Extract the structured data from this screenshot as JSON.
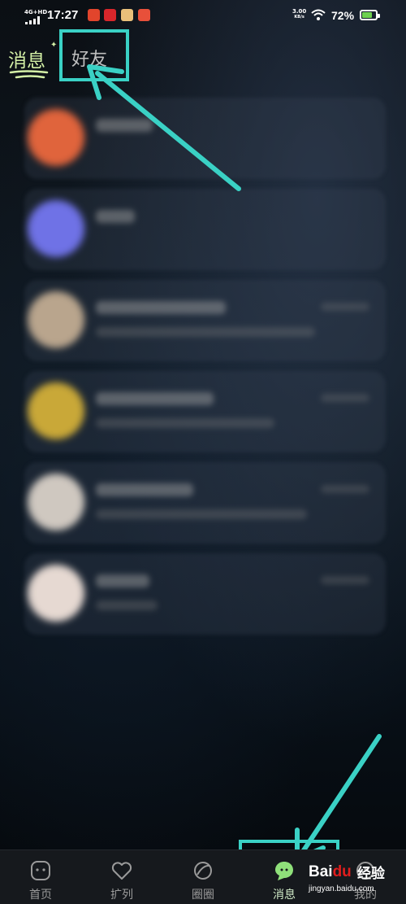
{
  "status_bar": {
    "network": "4G+HD",
    "time": "17:27",
    "net_speed_value": "3.00",
    "net_speed_unit": "KB/s",
    "battery_percent": "72%",
    "battery_level": 0.72
  },
  "top_tabs": {
    "messages_label": "消息",
    "friends_label": "好友"
  },
  "conversations": [
    {
      "avatar_color": "#e0643c"
    },
    {
      "avatar_color": "#6f72e6"
    },
    {
      "avatar_color": "#b9a58d"
    },
    {
      "avatar_color": "#c9a838"
    },
    {
      "avatar_color": "#cfc8c0"
    },
    {
      "avatar_color": "#e6d9d2"
    }
  ],
  "bottom_nav": {
    "items": [
      {
        "label": "首页",
        "icon": "home-face-icon"
      },
      {
        "label": "扩列",
        "icon": "heart-icon"
      },
      {
        "label": "圈圈",
        "icon": "circle-icon"
      },
      {
        "label": "消息",
        "icon": "chat-bubble-icon"
      },
      {
        "label": "我的",
        "icon": "profile-icon"
      }
    ],
    "active_index": 3
  },
  "watermark": {
    "logo_prefix": "Bai",
    "logo_suffix": "du",
    "service_name": "经验",
    "domain": "jingyan.baidu.com"
  },
  "colors": {
    "accent_green": "#d4f0a6",
    "highlight_cyan": "#3ad1c5",
    "active_chat_green": "#8fe07a"
  }
}
